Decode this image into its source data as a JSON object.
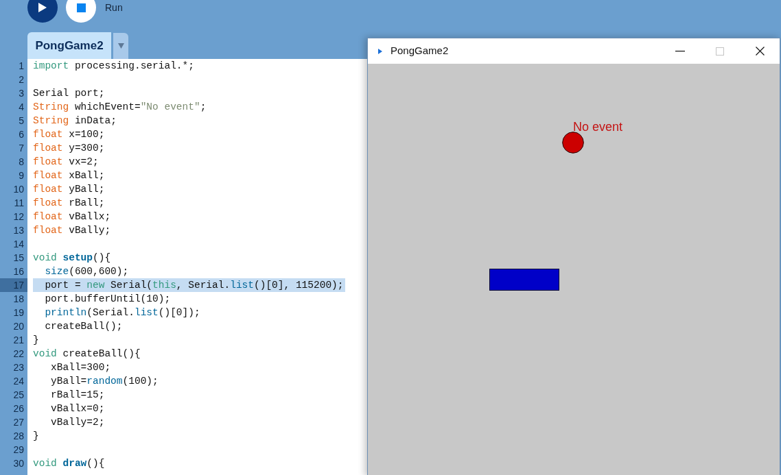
{
  "toolbar": {
    "buttons": [
      {
        "kind": "run",
        "active": true
      },
      {
        "kind": "stop",
        "active": false
      }
    ],
    "label": "Run"
  },
  "tabs": [
    {
      "label": "PongGame2",
      "selected": true
    }
  ],
  "editor": {
    "lines": [
      {
        "number": "1",
        "selected": false,
        "tokens": [
          {
            "text": "import",
            "kind": "keyword"
          },
          {
            "text": " processing.serial.*;",
            "kind": "plain"
          }
        ]
      },
      {
        "number": "2",
        "selected": false
      },
      {
        "number": "3",
        "selected": false,
        "tokens": [
          {
            "text": "Serial port;",
            "kind": "plain"
          }
        ]
      },
      {
        "number": "4",
        "selected": false,
        "tokens": [
          {
            "text": "String",
            "kind": "type"
          },
          {
            "text": " whichEvent=",
            "kind": "plain"
          },
          {
            "text": "\"No event\"",
            "kind": "string"
          },
          {
            "text": ";",
            "kind": "plain"
          }
        ]
      },
      {
        "number": "5",
        "selected": false,
        "tokens": [
          {
            "text": "String",
            "kind": "type"
          },
          {
            "text": " inData;",
            "kind": "plain"
          }
        ]
      },
      {
        "number": "6",
        "selected": false,
        "tokens": [
          {
            "text": "float",
            "kind": "type"
          },
          {
            "text": " x=100;",
            "kind": "plain"
          }
        ]
      },
      {
        "number": "7",
        "selected": false,
        "tokens": [
          {
            "text": "float",
            "kind": "type"
          },
          {
            "text": " y=300;",
            "kind": "plain"
          }
        ]
      },
      {
        "number": "8",
        "selected": false,
        "tokens": [
          {
            "text": "float",
            "kind": "type"
          },
          {
            "text": " vx=2;",
            "kind": "plain"
          }
        ]
      },
      {
        "number": "9",
        "selected": false,
        "tokens": [
          {
            "text": "float",
            "kind": "type"
          },
          {
            "text": " xBall;",
            "kind": "plain"
          }
        ]
      },
      {
        "number": "10",
        "selected": false,
        "tokens": [
          {
            "text": "float",
            "kind": "type"
          },
          {
            "text": " yBall;",
            "kind": "plain"
          }
        ]
      },
      {
        "number": "11",
        "selected": false,
        "tokens": [
          {
            "text": "float",
            "kind": "type"
          },
          {
            "text": " rBall;",
            "kind": "plain"
          }
        ]
      },
      {
        "number": "12",
        "selected": false,
        "tokens": [
          {
            "text": "float",
            "kind": "type"
          },
          {
            "text": " vBallx;",
            "kind": "plain"
          }
        ]
      },
      {
        "number": "13",
        "selected": false,
        "tokens": [
          {
            "text": "float",
            "kind": "type"
          },
          {
            "text": " vBally;",
            "kind": "plain"
          }
        ]
      },
      {
        "number": "14",
        "selected": false
      },
      {
        "number": "15",
        "selected": false,
        "tokens": [
          {
            "text": "void ",
            "kind": "keyword"
          },
          {
            "text": "setup",
            "kind": "function"
          },
          {
            "text": "(){",
            "kind": "plain"
          }
        ]
      },
      {
        "number": "16",
        "selected": false,
        "tokens": [
          {
            "text": "  size",
            "kind": "builtin"
          },
          {
            "text": "(600,600);",
            "kind": "plain"
          }
        ]
      },
      {
        "number": "17",
        "selected": true,
        "tokens": [
          {
            "text": "  port = ",
            "kind": "plain"
          },
          {
            "text": "new",
            "kind": "keyword"
          },
          {
            "text": " Serial(",
            "kind": "plain"
          },
          {
            "text": "this",
            "kind": "keyword"
          },
          {
            "text": ", Serial.",
            "kind": "plain"
          },
          {
            "text": "list",
            "kind": "builtin"
          },
          {
            "text": "()[0], 115200);",
            "kind": "plain"
          }
        ]
      },
      {
        "number": "18",
        "selected": false,
        "tokens": [
          {
            "text": "  port.bufferUntil(10);",
            "kind": "plain"
          }
        ]
      },
      {
        "number": "19",
        "selected": false,
        "tokens": [
          {
            "text": "  println",
            "kind": "builtin"
          },
          {
            "text": "(Serial.",
            "kind": "plain"
          },
          {
            "text": "list",
            "kind": "builtin"
          },
          {
            "text": "()[0]);",
            "kind": "plain"
          }
        ]
      },
      {
        "number": "20",
        "selected": false,
        "tokens": [
          {
            "text": "  createBall();",
            "kind": "plain"
          }
        ]
      },
      {
        "number": "21",
        "selected": false,
        "tokens": [
          {
            "text": "}",
            "kind": "plain"
          }
        ]
      },
      {
        "number": "22",
        "selected": false,
        "tokens": [
          {
            "text": "void",
            "kind": "keyword"
          },
          {
            "text": " createBall(){",
            "kind": "plain"
          }
        ]
      },
      {
        "number": "23",
        "selected": false,
        "tokens": [
          {
            "text": "   xBall=300;",
            "kind": "plain"
          }
        ]
      },
      {
        "number": "24",
        "selected": false,
        "tokens": [
          {
            "text": "   yBall=",
            "kind": "plain"
          },
          {
            "text": "random",
            "kind": "builtin"
          },
          {
            "text": "(100);",
            "kind": "plain"
          }
        ]
      },
      {
        "number": "25",
        "selected": false,
        "tokens": [
          {
            "text": "   rBall=15;",
            "kind": "plain"
          }
        ]
      },
      {
        "number": "26",
        "selected": false,
        "tokens": [
          {
            "text": "   vBallx=0;",
            "kind": "plain"
          }
        ]
      },
      {
        "number": "27",
        "selected": false,
        "tokens": [
          {
            "text": "   vBally=2;",
            "kind": "plain"
          }
        ]
      },
      {
        "number": "28",
        "selected": false,
        "tokens": [
          {
            "text": "}",
            "kind": "plain"
          }
        ]
      },
      {
        "number": "29",
        "selected": false
      },
      {
        "number": "30",
        "selected": false,
        "tokens": [
          {
            "text": "void ",
            "kind": "keyword"
          },
          {
            "text": "draw",
            "kind": "function"
          },
          {
            "text": "(){",
            "kind": "plain"
          }
        ]
      }
    ]
  },
  "sketch_window": {
    "title": "PongGame2",
    "controls": [
      {
        "kind": "minimize",
        "disabled": false
      },
      {
        "kind": "maximize",
        "disabled": true
      },
      {
        "kind": "close",
        "disabled": false
      }
    ],
    "canvas": {
      "text": "No event"
    }
  }
}
